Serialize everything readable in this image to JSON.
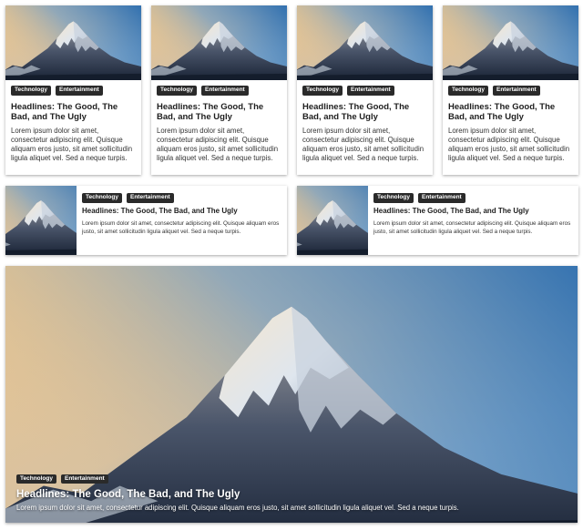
{
  "tags": [
    "Technology",
    "Entertainment"
  ],
  "headline": "Headlines: The Good, The Bad, and The Ugly",
  "excerpt": "Lorem ipsum dolor sit amet, consectetur adipiscing elit. Quisque aliquam eros justo, sit amet sollicitudin ligula aliquet vel. Sed a neque turpis.",
  "image_subject": "snowy-mountain-peak",
  "colors": {
    "tag_bg": "#2a2a2a",
    "sky_top": "#3f7fb8",
    "sky_warm": "#e8c08a",
    "mountain_dark": "#1d2a3d",
    "snow": "#e8eef5"
  },
  "cards": {
    "vertical": [
      {
        "tags": [
          "Technology",
          "Entertainment"
        ],
        "title": "Headlines: The Good, The Bad, and The Ugly",
        "body": "Lorem ipsum dolor sit amet, consectetur adipiscing elit. Quisque aliquam eros justo, sit amet sollicitudin ligula aliquet vel. Sed a neque turpis."
      },
      {
        "tags": [
          "Technology",
          "Entertainment"
        ],
        "title": "Headlines: The Good, The Bad, and The Ugly",
        "body": "Lorem ipsum dolor sit amet, consectetur adipiscing elit. Quisque aliquam eros justo, sit amet sollicitudin ligula aliquet vel. Sed a neque turpis."
      },
      {
        "tags": [
          "Technology",
          "Entertainment"
        ],
        "title": "Headlines: The Good, The Bad, and The Ugly",
        "body": "Lorem ipsum dolor sit amet, consectetur adipiscing elit. Quisque aliquam eros justo, sit amet sollicitudin ligula aliquet vel. Sed a neque turpis."
      },
      {
        "tags": [
          "Technology",
          "Entertainment"
        ],
        "title": "Headlines: The Good, The Bad, and The Ugly",
        "body": "Lorem ipsum dolor sit amet, consectetur adipiscing elit. Quisque aliquam eros justo, sit amet sollicitudin ligula aliquet vel. Sed a neque turpis."
      }
    ],
    "horizontal": [
      {
        "tags": [
          "Technology",
          "Entertainment"
        ],
        "title": "Headlines: The Good, The Bad, and The Ugly",
        "body": "Lorem ipsum dolor sit amet, consectetur adipiscing elit. Quisque aliquam eros justo, sit amet sollicitudin ligula aliquet vel. Sed a neque turpis."
      },
      {
        "tags": [
          "Technology",
          "Entertainment"
        ],
        "title": "Headlines: The Good, The Bad, and The Ugly",
        "body": "Lorem ipsum dolor sit amet, consectetur adipiscing elit. Quisque aliquam eros justo, sit amet sollicitudin ligula aliquet vel. Sed a neque turpis."
      }
    ],
    "hero": {
      "tags": [
        "Technology",
        "Entertainment"
      ],
      "title": "Headlines: The Good, The Bad, and The Ugly",
      "body": "Lorem ipsum dolor sit amet, consectetur adipiscing elit. Quisque aliquam eros justo, sit amet sollicitudin ligula aliquet vel. Sed a neque turpis."
    }
  }
}
